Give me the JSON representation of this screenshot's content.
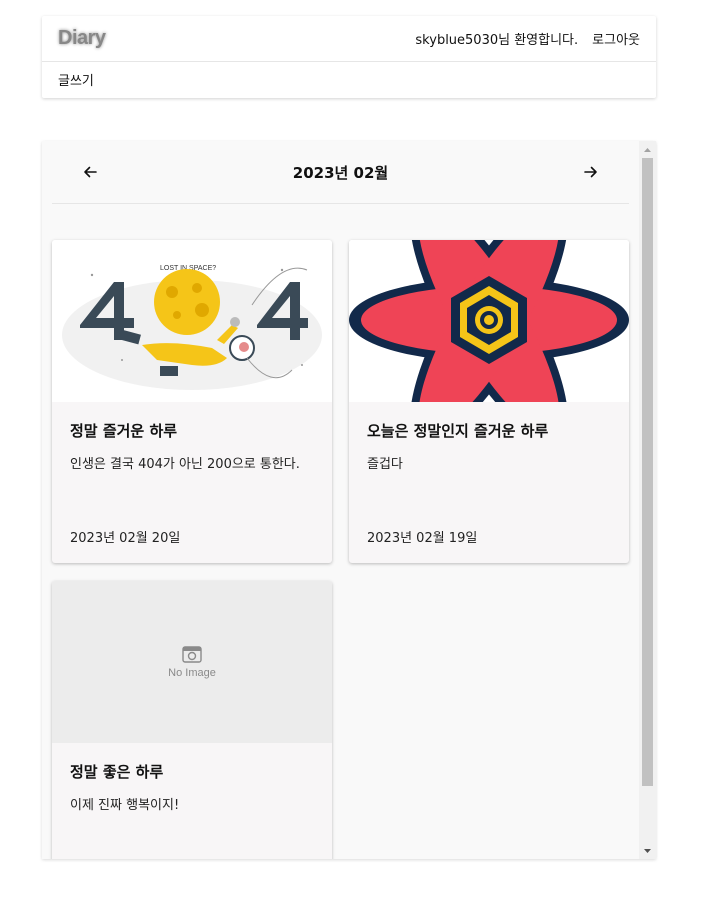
{
  "header": {
    "logo": "Diary",
    "welcome": "skyblue5030님 환영합니다.",
    "logout": "로그아웃",
    "write": "글쓰기"
  },
  "calendar": {
    "month_label": "2023년 02월",
    "prev_icon": "arrow-left-icon",
    "next_icon": "arrow-right-icon"
  },
  "posts": [
    {
      "title": "정말 즐거운 하루",
      "content": "인생은 결국 404가 아닌 200으로 통한다.",
      "date": "2023년 02월 20일",
      "image_text": "LOST IN SPACE?"
    },
    {
      "title": "오늘은 정말인지 즐거운 하루",
      "content": "즐겁다",
      "date": "2023년 02월 19일"
    },
    {
      "title": "정말 좋은 하루",
      "content": "이제 진짜 행복이지!",
      "date": "",
      "no_image_label": "No Image"
    }
  ]
}
